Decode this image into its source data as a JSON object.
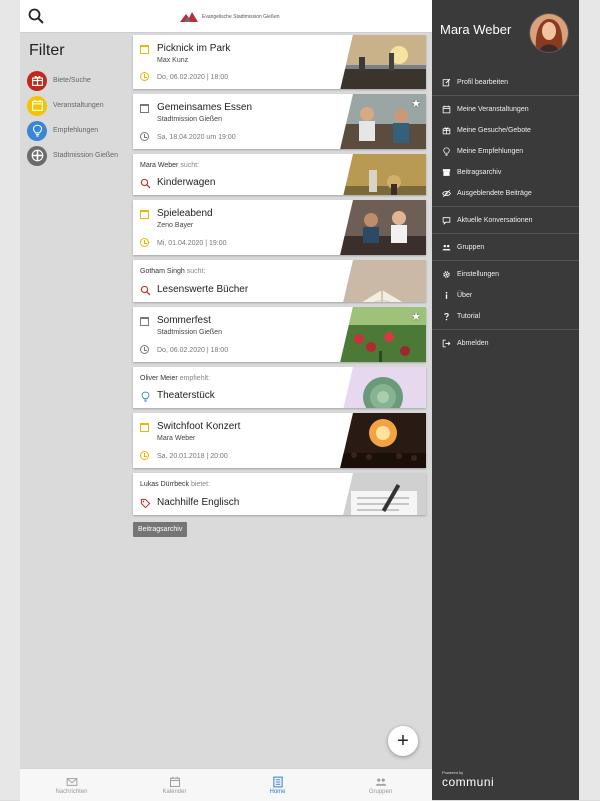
{
  "header": {
    "logo_text": "Evangelische Stadtmission Gießen"
  },
  "filter": {
    "title": "Filter",
    "items": [
      {
        "label": "Biete/Suche",
        "color": "#c2291c",
        "icon": "gift-icon"
      },
      {
        "label": "Veranstaltungen",
        "color": "#f5c400",
        "icon": "calendar-icon"
      },
      {
        "label": "Empfehlungen",
        "color": "#3a86d4",
        "icon": "lightbulb-icon"
      },
      {
        "label": "Stadtmission Gießen",
        "color": "#6b6b6b",
        "icon": "group-cross-icon"
      }
    ]
  },
  "feed": {
    "cards": [
      {
        "type": "event",
        "title": "Picknick im Park",
        "org": "Max Kunz",
        "date": "Do, 06.02.2020 | 18:00",
        "accent": "#f0b400",
        "starred": false
      },
      {
        "type": "event",
        "title": "Gemeinsames Essen",
        "org": "Stadtmission Gießen",
        "date": "Sa, 18.04.2020 um 19:00",
        "accent": "#777777",
        "starred": true
      },
      {
        "type": "request",
        "user": "Mara Weber",
        "verb": "sucht:",
        "title": "Kinderwagen",
        "icon": "search-icon",
        "accent": "#c2291c"
      },
      {
        "type": "event",
        "title": "Spieleabend",
        "org": "Zeno Bayer",
        "date": "Mi, 01.04.2020 | 19:00",
        "accent": "#f0b400",
        "starred": false
      },
      {
        "type": "request",
        "user": "Gotham Singh",
        "verb": "sucht:",
        "title": "Lesenswerte Bücher",
        "icon": "search-icon",
        "accent": "#c2291c"
      },
      {
        "type": "event",
        "title": "Sommerfest",
        "org": "Stadtmission Gießen",
        "date": "Do, 06.02.2020 | 18:00",
        "accent": "#777777",
        "starred": true
      },
      {
        "type": "request",
        "user": "Oliver Meier",
        "verb": "empfiehlt:",
        "title": "Theaterstück",
        "icon": "lightbulb-icon",
        "accent": "#3a86d4"
      },
      {
        "type": "event",
        "title": "Switchfoot Konzert",
        "org": "Mara Weber",
        "date": "Sa, 20.01.2018 | 20:00",
        "accent": "#f0b400",
        "starred": false
      },
      {
        "type": "request",
        "user": "Lukas Dürrbeck",
        "verb": "bietet:",
        "title": "Nachhilfe Englisch",
        "icon": "tag-icon",
        "accent": "#c2291c"
      }
    ],
    "archive_label": "Beitragsarchiv"
  },
  "fab": {
    "label": "+"
  },
  "bottom_nav": [
    {
      "label": "Nachrichten",
      "icon": "mail-icon",
      "active": false
    },
    {
      "label": "Kalender",
      "icon": "calendar-icon",
      "active": false
    },
    {
      "label": "Home",
      "icon": "home-list-icon",
      "active": true
    },
    {
      "label": "Gruppen",
      "icon": "people-icon",
      "active": false
    }
  ],
  "drawer": {
    "user_name": "Mara Weber",
    "menu": [
      {
        "label": "Profil bearbeiten",
        "icon": "edit-icon"
      },
      {
        "sep": true
      },
      {
        "label": "Meine Veranstaltungen",
        "icon": "calendar-icon"
      },
      {
        "label": "Meine Gesuche/Gebote",
        "icon": "gift-icon"
      },
      {
        "label": "Meine Empfehlungen",
        "icon": "lightbulb-icon"
      },
      {
        "label": "Beitragsarchiv",
        "icon": "archive-icon"
      },
      {
        "label": "Ausgeblendete Beiträge",
        "icon": "eye-off-icon"
      },
      {
        "sep": true
      },
      {
        "label": "Aktuelle Konversationen",
        "icon": "chat-icon"
      },
      {
        "sep": true
      },
      {
        "label": "Gruppen",
        "icon": "people-icon"
      },
      {
        "sep": true
      },
      {
        "label": "Einstellungen",
        "icon": "gear-icon"
      },
      {
        "label": "Über",
        "icon": "info-icon"
      },
      {
        "label": "Tutorial",
        "icon": "help-icon"
      },
      {
        "sep": true
      },
      {
        "label": "Abmelden",
        "icon": "logout-icon"
      }
    ],
    "powered_by": "Powered by",
    "brand": "communi"
  }
}
